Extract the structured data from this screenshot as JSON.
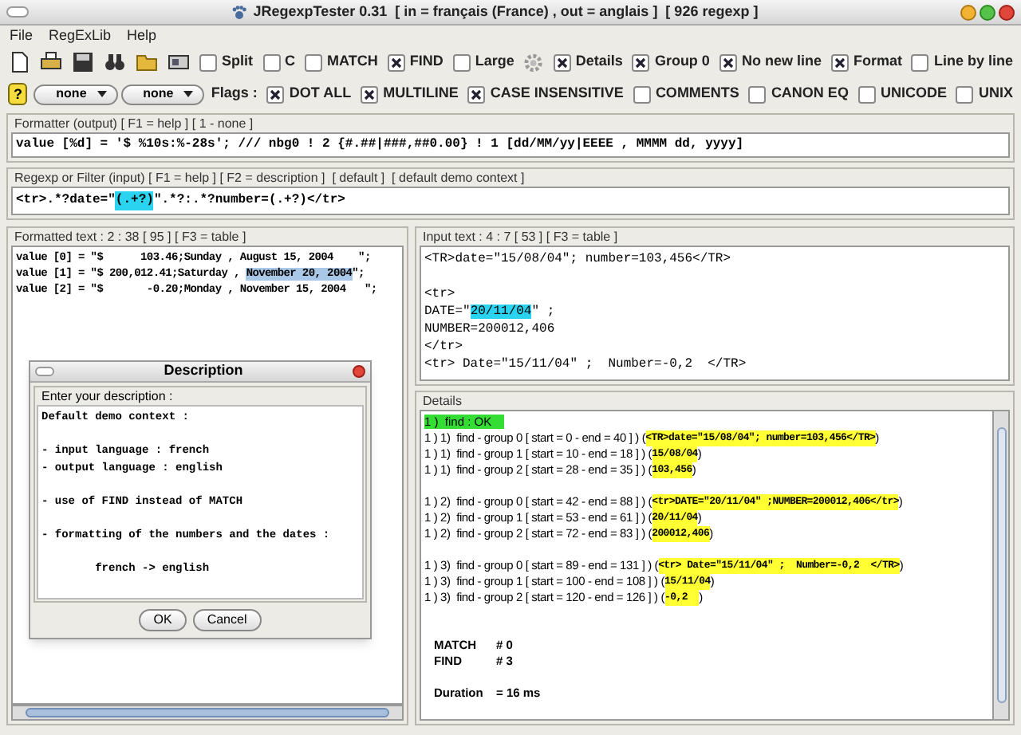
{
  "window": {
    "title": "JRegexpTester 0.31  [ in = français (France) , out = anglais ]  [ 926 regexp ]"
  },
  "menu": [
    "File",
    "RegExLib",
    "Help"
  ],
  "toolbar": {
    "options": [
      {
        "label": "Split",
        "checked": false
      },
      {
        "label": "C",
        "checked": false
      },
      {
        "label": "MATCH",
        "checked": false
      },
      {
        "label": "FIND",
        "checked": true
      },
      {
        "label": "Large",
        "checked": false
      },
      {
        "kind": "gear"
      },
      {
        "label": "Details",
        "checked": true
      },
      {
        "label": "Group 0",
        "checked": true
      },
      {
        "label": "No new line",
        "checked": true
      },
      {
        "label": "Format",
        "checked": true
      },
      {
        "label": "Line by line",
        "checked": false
      }
    ]
  },
  "flags_bar": {
    "help": "?",
    "selects": [
      "none",
      "none"
    ],
    "label": "Flags :",
    "flags": [
      {
        "label": "DOT ALL",
        "checked": true
      },
      {
        "label": "MULTILINE",
        "checked": true
      },
      {
        "label": "CASE INSENSITIVE",
        "checked": true
      },
      {
        "label": "COMMENTS",
        "checked": false
      },
      {
        "label": "CANON EQ",
        "checked": false
      },
      {
        "label": "UNICODE",
        "checked": false
      },
      {
        "label": "UNIX",
        "checked": false
      }
    ]
  },
  "formatter": {
    "title": "Formatter (output) [ F1 = help ] [ 1 - none ]",
    "value": "value [%d] = '$ %10s:%-28s'; /// nbg0 ! 2 {#.##|###,##0.00} ! 1 [dd/MM/yy|EEEE , MMMM dd, yyyy]"
  },
  "regexp": {
    "title": "Regexp or Filter (input) [ F1 = help ] [ F2 = description ]  [ default ]  [ default demo context ]",
    "segments": [
      {
        "text": "<tr>.*?date=\"",
        "highlighted": false
      },
      {
        "text": "(.+?)",
        "highlighted": true
      },
      {
        "text": "\".*?:.*?number=(.+?)</tr>",
        "highlighted": false
      }
    ]
  },
  "formatted_text": {
    "title": "Formatted text : 2 : 38 [ 95 ] [ F3 = table ]",
    "lines": [
      [
        {
          "text": "value [0] = \"$      103.46;Sunday , August 15, 2004    \";",
          "highlighted": false
        }
      ],
      [
        {
          "text": "value [1] = \"$ 200,012.41;Saturday , ",
          "highlighted": false
        },
        {
          "text": "November 20, 2004",
          "highlighted": true
        },
        {
          "text": "\";",
          "highlighted": false
        }
      ],
      [
        {
          "text": "value [2] = \"$       -0.20;Monday , November 15, 2004   \";",
          "highlighted": false
        }
      ]
    ]
  },
  "input_text": {
    "title": "Input text : 4 : 7 [ 53 ] [ F3 = table ]",
    "lines": [
      {
        "kind": "text",
        "segments": [
          {
            "text": "<TR>date=\"15/08/04\"; number=103,456</TR>",
            "highlighted": false
          }
        ]
      },
      {
        "kind": "blank"
      },
      {
        "kind": "text",
        "segments": [
          {
            "text": "<tr>",
            "highlighted": false
          }
        ]
      },
      {
        "kind": "text",
        "segments": [
          {
            "text": "DATE=\"",
            "highlighted": false
          },
          {
            "text": "20/11/04",
            "highlighted": true
          },
          {
            "text": "\" ;",
            "highlighted": false
          }
        ]
      },
      {
        "kind": "text",
        "segments": [
          {
            "text": "NUMBER=200012,406",
            "highlighted": false
          }
        ]
      },
      {
        "kind": "text",
        "segments": [
          {
            "text": "</tr>",
            "highlighted": false
          }
        ]
      },
      {
        "kind": "text",
        "segments": [
          {
            "text": "<tr> Date=\"15/11/04\" ;  Number=-0,2  </TR>",
            "highlighted": false
          }
        ]
      }
    ]
  },
  "details": {
    "title": "Details",
    "lines": [
      {
        "kind": "status",
        "text": "1 )  find : OK"
      },
      {
        "kind": "find",
        "text": "1 ) 1)  find - group 0 [ start = 0 - end = 40 ] ) (",
        "match": "<TR>date=\"15/08/04\"; number=103,456</TR>",
        "close": ")"
      },
      {
        "kind": "find",
        "text": "1 ) 1)  find - group 1 [ start = 10 - end = 18 ] ) (",
        "match": "15/08/04",
        "close": ")"
      },
      {
        "kind": "find",
        "text": "1 ) 1)  find - group 2 [ start = 28 - end = 35 ] ) (",
        "match": "103,456",
        "close": ")"
      },
      {
        "kind": "blank"
      },
      {
        "kind": "find",
        "text": "1 ) 2)  find - group 0 [ start = 42 - end = 88 ] ) (",
        "match": "<tr>DATE=\"20/11/04\" ;NUMBER=200012,406</tr>",
        "close": ")"
      },
      {
        "kind": "find",
        "text": "1 ) 2)  find - group 1 [ start = 53 - end = 61 ] ) (",
        "match": "20/11/04",
        "close": ")"
      },
      {
        "kind": "find",
        "text": "1 ) 2)  find - group 2 [ start = 72 - end = 83 ] ) (",
        "match": "200012,406",
        "close": ")"
      },
      {
        "kind": "blank"
      },
      {
        "kind": "find",
        "text": "1 ) 3)  find - group 0 [ start = 89 - end = 131 ] ) (",
        "match": "<tr> Date=\"15/11/04\" ;  Number=-0,2  </TR>",
        "close": ")"
      },
      {
        "kind": "find",
        "text": "1 ) 3)  find - group 1 [ start = 100 - end = 108 ] ) (",
        "match": "15/11/04",
        "close": ")"
      },
      {
        "kind": "find",
        "text": "1 ) 3)  find - group 2 [ start = 120 - end = 126 ] ) (",
        "match": "-0,2  ",
        "close": ")"
      },
      {
        "kind": "blank"
      },
      {
        "kind": "blank"
      },
      {
        "kind": "summary",
        "label": "MATCH",
        "value": "# 0"
      },
      {
        "kind": "summary",
        "label": "FIND",
        "value": "# 3"
      },
      {
        "kind": "blank"
      },
      {
        "kind": "summary",
        "label": "Duration",
        "value": "= 16 ms"
      }
    ]
  },
  "dialog": {
    "title": "Description",
    "group_label": "Enter your description :",
    "lines": [
      {
        "kind": "text",
        "text": "Default demo context :"
      },
      {
        "kind": "blank"
      },
      {
        "kind": "text",
        "text": "- input language : french"
      },
      {
        "kind": "text",
        "text": "- output language : english"
      },
      {
        "kind": "blank"
      },
      {
        "kind": "text",
        "text": "- use of FIND instead of MATCH"
      },
      {
        "kind": "blank"
      },
      {
        "kind": "text",
        "text": "- formatting of the numbers and the dates :"
      },
      {
        "kind": "blank"
      },
      {
        "kind": "text",
        "text": "        french -> english"
      }
    ],
    "buttons": [
      "OK",
      "Cancel"
    ]
  }
}
